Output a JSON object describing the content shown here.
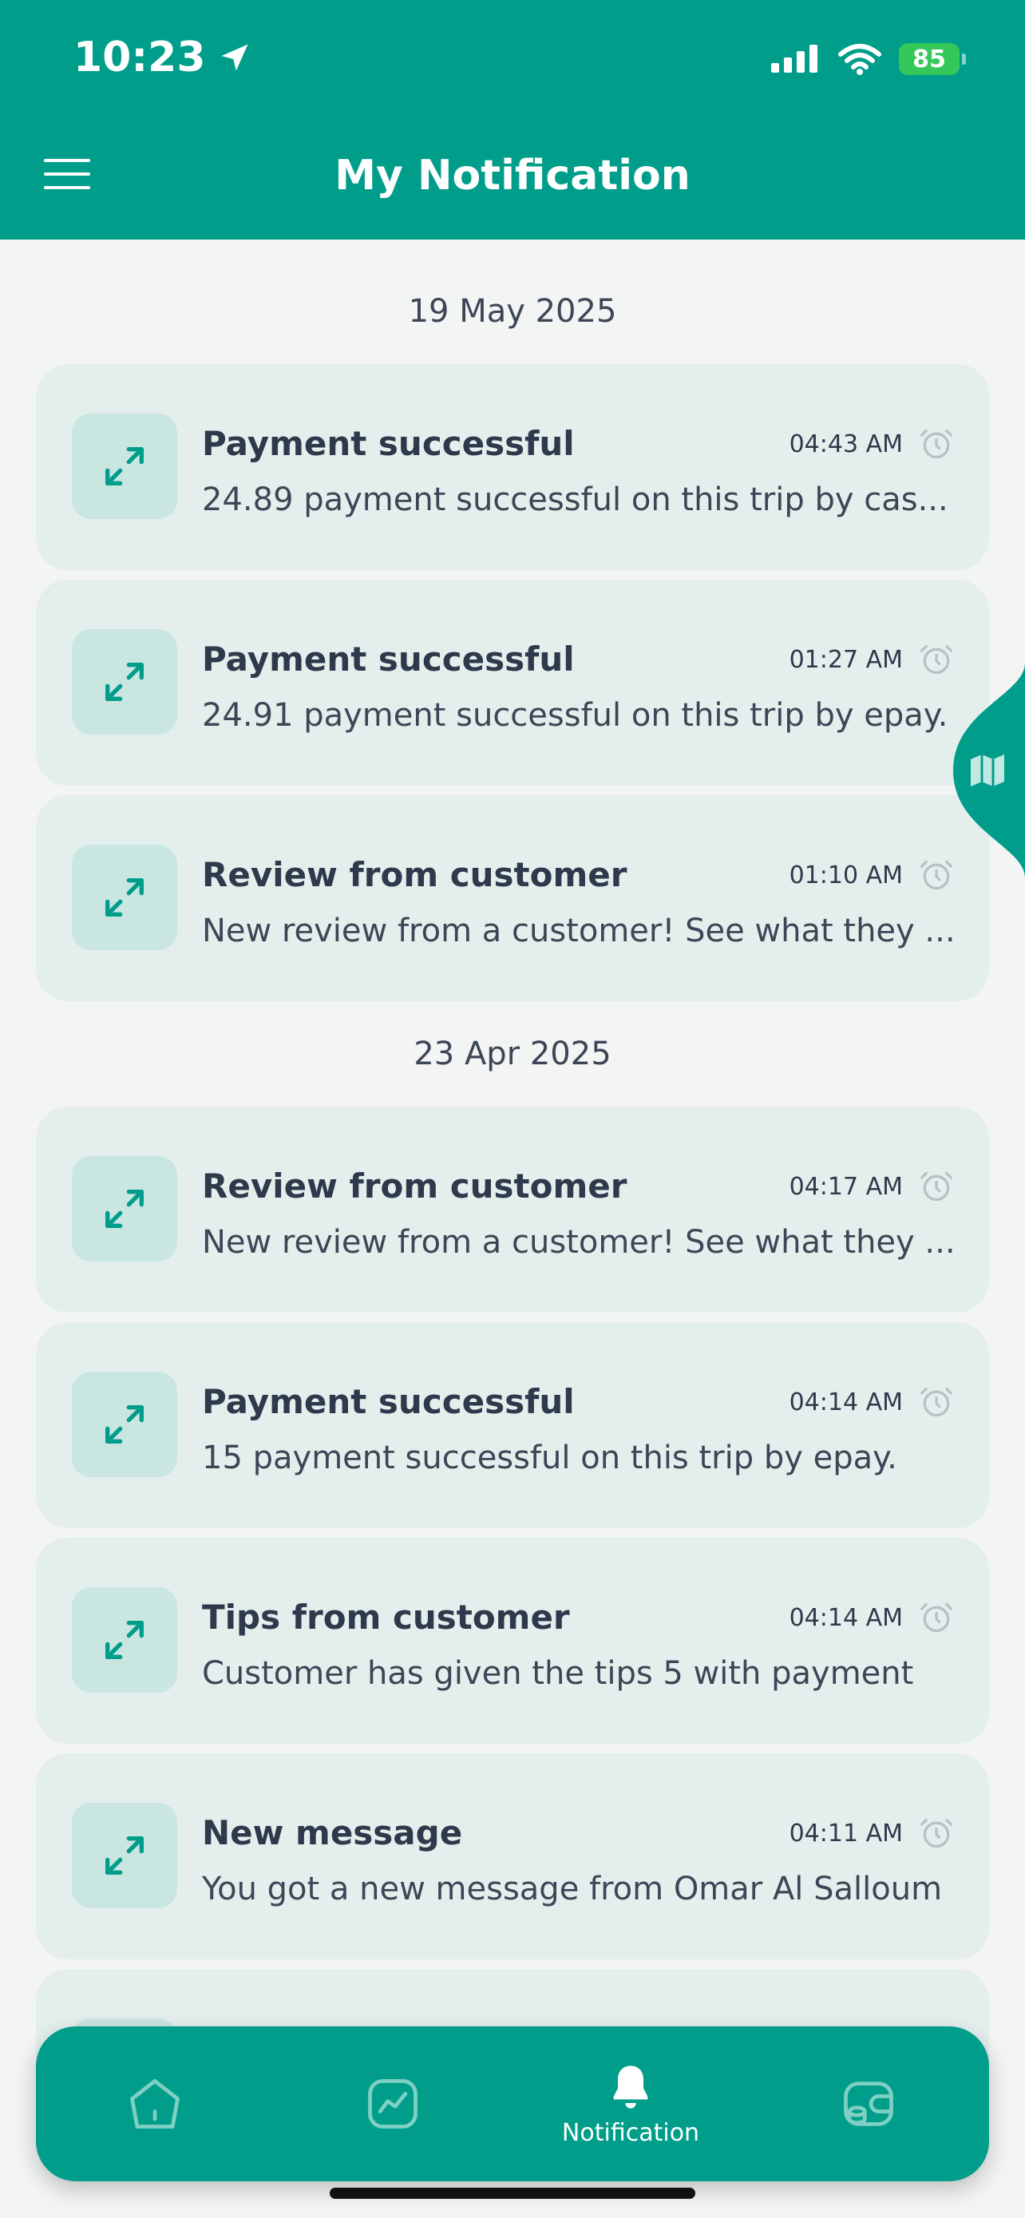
{
  "status_bar": {
    "time": "10:23",
    "battery": "85"
  },
  "header": {
    "title": "My Notification"
  },
  "groups": [
    {
      "date": "19 May 2025",
      "items": [
        {
          "title": "Payment successful",
          "time": "04:43 AM",
          "text": "24.89 payment successful on this trip by cas..."
        },
        {
          "title": "Payment successful",
          "time": "01:27 AM",
          "text": "24.91 payment successful on this trip by epay."
        },
        {
          "title": "Review from customer",
          "time": "01:10 AM",
          "text": "New review from a customer! See what they ..."
        }
      ]
    },
    {
      "date": "23 Apr 2025",
      "items": [
        {
          "title": "Review from customer",
          "time": "04:17 AM",
          "text": "New review from a customer! See what they ..."
        },
        {
          "title": "Payment successful",
          "time": "04:14 AM",
          "text": "15 payment successful on this trip by epay."
        },
        {
          "title": "Tips from customer",
          "time": "04:14 AM",
          "text": "Customer has given the tips 5 with payment"
        },
        {
          "title": "New message",
          "time": "04:11 AM",
          "text": "You got a new message from Omar Al Salloum"
        }
      ]
    }
  ],
  "bottom_nav": {
    "items": [
      {
        "icon": "home-icon",
        "label": ""
      },
      {
        "icon": "chart-icon",
        "label": ""
      },
      {
        "icon": "bell-icon",
        "label": "Notification",
        "active": true
      },
      {
        "icon": "wallet-icon",
        "label": ""
      }
    ]
  },
  "colors": {
    "primary": "#009e8a",
    "card_bg": "#e4efed",
    "icon_bg": "#cae6e1",
    "page_bg": "#f3f4f4"
  }
}
